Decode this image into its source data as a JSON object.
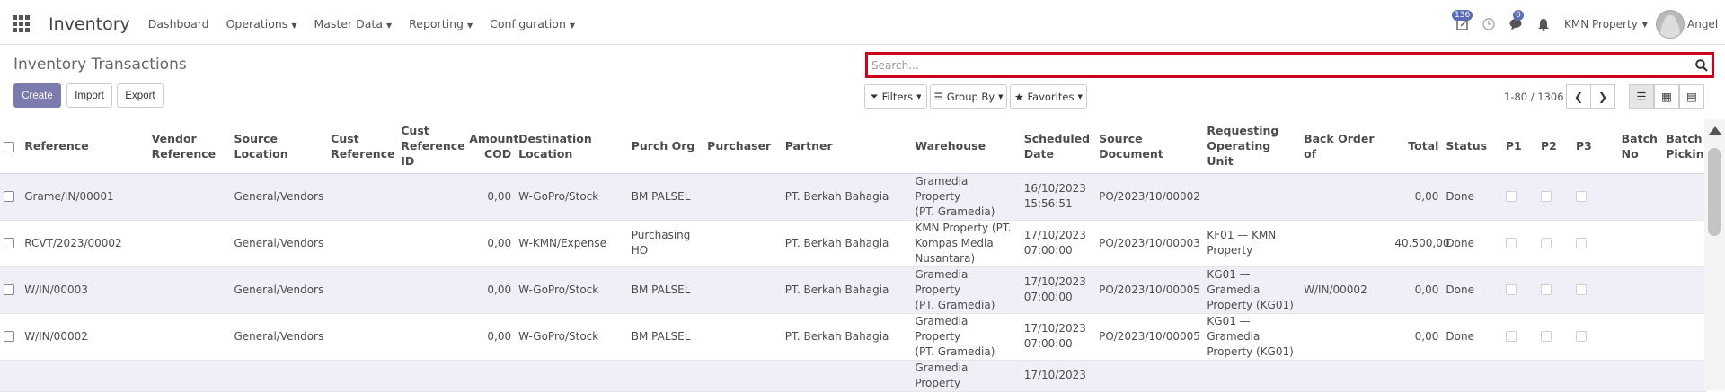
{
  "app": {
    "name": "Inventory"
  },
  "nav": {
    "menus": [
      {
        "label": "Dashboard",
        "caret": false
      },
      {
        "label": "Operations",
        "caret": true
      },
      {
        "label": "Master Data",
        "caret": true
      },
      {
        "label": "Reporting",
        "caret": true
      },
      {
        "label": "Configuration",
        "caret": true
      }
    ]
  },
  "systray": {
    "activity_count": "136",
    "messages_count": "0",
    "company": "KMN Property",
    "user": "Angel"
  },
  "page": {
    "title": "Inventory Transactions"
  },
  "buttons": {
    "create": "Create",
    "import": "Import",
    "export": "Export"
  },
  "search": {
    "placeholder": "Search...",
    "value": ""
  },
  "filters": {
    "filters": "Filters",
    "group_by": "Group By",
    "favorites": "Favorites"
  },
  "pager": {
    "text": "1-80 / 1306"
  },
  "table": {
    "headers": {
      "reference": "Reference",
      "vendor_ref": [
        "Vendor",
        "Reference"
      ],
      "source_location": [
        "Source",
        "Location"
      ],
      "cust_ref": [
        "Cust",
        "Reference"
      ],
      "cust_ref_id": [
        "Cust",
        "Reference",
        "ID"
      ],
      "amount_cod": [
        "Amount",
        "COD"
      ],
      "dest_location": [
        "Destination",
        "Location"
      ],
      "purch_org": "Purch Org",
      "purchaser": "Purchaser",
      "partner": "Partner",
      "warehouse": "Warehouse",
      "scheduled_date": [
        "Scheduled",
        "Date"
      ],
      "source_document": [
        "Source",
        "Document"
      ],
      "req_unit": [
        "Requesting",
        "Operating",
        "Unit"
      ],
      "back_order": "Back Order of",
      "total": "Total",
      "status": "Status",
      "p1": "P1",
      "p2": "P2",
      "p3": "P3",
      "batch_no": [
        "Batch",
        "No"
      ],
      "batch_picking": [
        "Batch",
        "Picking"
      ]
    },
    "rows": [
      {
        "reference": "Grame/IN/00001",
        "vendor_ref": "",
        "source_location": "General/Vendors",
        "cust_ref": "",
        "cust_ref_id": "",
        "amount_cod": "0,00",
        "dest_location": "W-GoPro/Stock",
        "purch_org": [
          "BM PALSEL"
        ],
        "purchaser": "",
        "partner": "PT. Berkah Bahagia",
        "warehouse": [
          "Gramedia Property",
          "(PT. Gramedia)"
        ],
        "scheduled_date": [
          "16/10/2023",
          "15:56:51"
        ],
        "source_document": "PO/2023/10/00002",
        "req_unit": [],
        "back_order": "",
        "total": "0,00",
        "status": "Done"
      },
      {
        "reference": "RCVT/2023/00002",
        "vendor_ref": "",
        "source_location": "General/Vendors",
        "cust_ref": "",
        "cust_ref_id": "",
        "amount_cod": "0,00",
        "dest_location": "W-KMN/Expense",
        "purch_org": [
          "Purchasing",
          "HO"
        ],
        "purchaser": "",
        "partner": "PT. Berkah Bahagia",
        "warehouse": [
          "KMN Property (PT.",
          "Kompas Media",
          "Nusantara)"
        ],
        "scheduled_date": [
          "17/10/2023",
          "07:00:00"
        ],
        "source_document": "PO/2023/10/00003",
        "req_unit": [
          "KF01 — KMN",
          "Property"
        ],
        "back_order": "",
        "total": "40.500,00",
        "status": "Done"
      },
      {
        "reference": "W/IN/00003",
        "vendor_ref": "",
        "source_location": "General/Vendors",
        "cust_ref": "",
        "cust_ref_id": "",
        "amount_cod": "0,00",
        "dest_location": "W-GoPro/Stock",
        "purch_org": [
          "BM PALSEL"
        ],
        "purchaser": "",
        "partner": "PT. Berkah Bahagia",
        "warehouse": [
          "Gramedia Property",
          "(PT. Gramedia)"
        ],
        "scheduled_date": [
          "17/10/2023",
          "07:00:00"
        ],
        "source_document": "PO/2023/10/00005",
        "req_unit": [
          "KG01 —",
          "Gramedia",
          "Property (KG01)"
        ],
        "back_order": "W/IN/00002",
        "total": "0,00",
        "status": "Done"
      },
      {
        "reference": "W/IN/00002",
        "vendor_ref": "",
        "source_location": "General/Vendors",
        "cust_ref": "",
        "cust_ref_id": "",
        "amount_cod": "0,00",
        "dest_location": "W-GoPro/Stock",
        "purch_org": [
          "BM PALSEL"
        ],
        "purchaser": "",
        "partner": "PT. Berkah Bahagia",
        "warehouse": [
          "Gramedia Property",
          "(PT. Gramedia)"
        ],
        "scheduled_date": [
          "17/10/2023",
          "07:00:00"
        ],
        "source_document": "PO/2023/10/00005",
        "req_unit": [
          "KG01 —",
          "Gramedia",
          "Property (KG01)"
        ],
        "back_order": "",
        "total": "0,00",
        "status": "Done"
      },
      {
        "reference": "",
        "vendor_ref": "",
        "source_location": "",
        "cust_ref": "",
        "cust_ref_id": "",
        "amount_cod": "",
        "dest_location": "",
        "purch_org": [],
        "purchaser": "",
        "partner": "",
        "warehouse": [
          "Gramedia Property"
        ],
        "scheduled_date": [
          "17/10/2023"
        ],
        "source_document": "",
        "req_unit": [],
        "back_order": "",
        "total": "",
        "status": ""
      }
    ]
  },
  "colors": {
    "primary": "#7c7bad",
    "highlight": "#d0021b",
    "row_alt": "#eff0f7"
  }
}
